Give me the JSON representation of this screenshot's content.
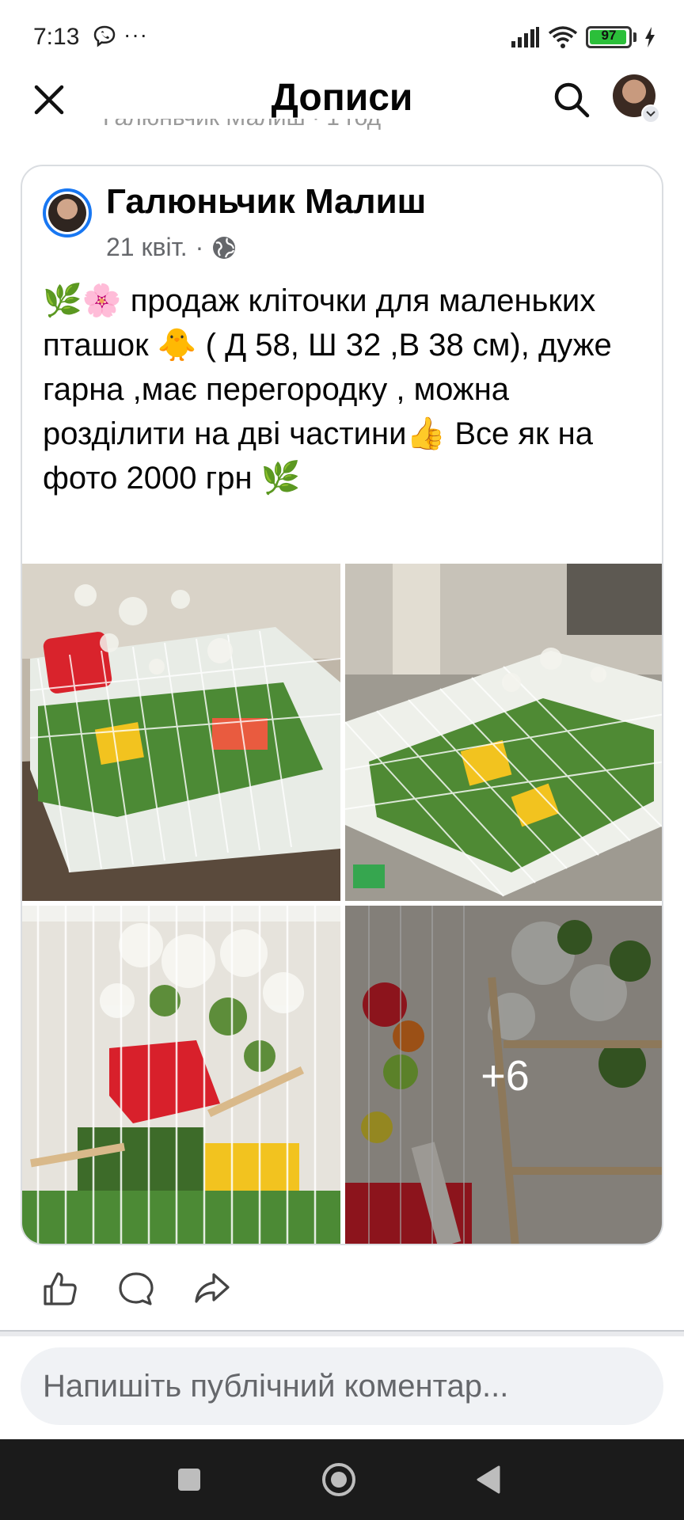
{
  "status_bar": {
    "time": "7:13",
    "dots": "···",
    "battery_level": "97",
    "battery_fraction": 0.97,
    "battery_color": "#2bbf3a"
  },
  "header": {
    "title": "Дописи",
    "close_icon": "close-icon",
    "search_icon": "search-icon"
  },
  "previous_post_fragment": "Галюньчик Малиш · 1 год",
  "post": {
    "author": "Галюньчик Малиш",
    "date": "21 квіт.",
    "separator": "·",
    "privacy_icon": "globe-icon",
    "text_lead": "🌿🌸",
    "text_1": " продаж кліточки для маленьких пташок ",
    "emoji_chick": "🐥",
    "text_2": " ( Д 58, Ш 32 ,В 38 см), дуже гарна  ,має перегородку , можна розділити на дві частини",
    "emoji_thumb": "👍",
    "text_3": " Все як на фото 2000 грн  ",
    "emoji_leaf": "🌿",
    "photos": [
      "photo-1",
      "photo-2",
      "photo-3",
      "photo-4"
    ],
    "more_photos": "+6"
  },
  "actions": {
    "like_icon": "like-icon",
    "comment_icon": "comment-icon",
    "share_icon": "share-icon"
  },
  "comment": {
    "placeholder": "Напишіть публічний коментар..."
  },
  "nav": {
    "recents_icon": "square-icon",
    "home_icon": "circle-icon",
    "back_icon": "triangle-back-icon"
  },
  "colors": {
    "accent": "#1877f2",
    "secondary_text": "#65676b",
    "comment_bg": "#f0f2f5",
    "nav_bg": "#1b1b1b"
  }
}
